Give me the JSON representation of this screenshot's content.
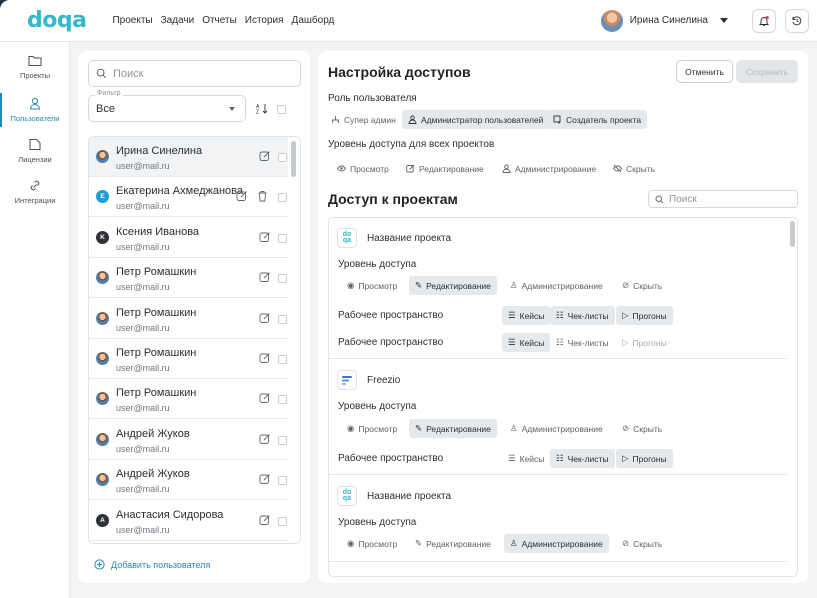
{
  "app": {
    "logo_text": "doqa"
  },
  "nav": [
    "Проекты",
    "Задачи",
    "Отчеты",
    "История",
    "Дашборд"
  ],
  "header": {
    "user_name": "Ирина Синелина"
  },
  "sidebar": {
    "items": [
      {
        "label": "Проекты",
        "icon": "folder-icon"
      },
      {
        "label": "Пользователи",
        "icon": "user-icon",
        "active": true
      },
      {
        "label": "Лицензии",
        "icon": "license-icon"
      },
      {
        "label": "Интеграции",
        "icon": "link-icon"
      }
    ]
  },
  "users_panel": {
    "search_placeholder": "Поиск",
    "filter_label": "Фильтр",
    "filter_value": "Все",
    "add_user_label": "Добавить пользователя",
    "users": [
      {
        "name": "Ирина Синелина",
        "email": "user@mail.ru",
        "avatar": "photo",
        "selected": true
      },
      {
        "name": "Екатерина Ахмеджанова",
        "email": "user@mail.ru",
        "avatar": "E"
      },
      {
        "name": "Ксения Иванова",
        "email": "user@mail.ru",
        "avatar": "K"
      },
      {
        "name": "Петр Ромашкин",
        "email": "user@mail.ru",
        "avatar": "photo"
      },
      {
        "name": "Петр Ромашкин",
        "email": "user@mail.ru",
        "avatar": "photo"
      },
      {
        "name": "Петр Ромашкин",
        "email": "user@mail.ru",
        "avatar": "photo"
      },
      {
        "name": "Петр Ромашкин",
        "email": "user@mail.ru",
        "avatar": "photo"
      },
      {
        "name": "Андрей Жуков",
        "email": "user@mail.ru",
        "avatar": "photo"
      },
      {
        "name": "Андрей Жуков",
        "email": "user@mail.ru",
        "avatar": "photo"
      },
      {
        "name": "Анастасия Сидорова",
        "email": "user@mail.ru",
        "avatar": "A"
      }
    ]
  },
  "access_settings": {
    "title": "Настройка доступов",
    "cancel_label": "Отменить",
    "save_label": "Сохранить",
    "role_label": "Роль пользователя",
    "roles": [
      "Супер админ",
      "Администратор пользователей",
      "Создатель проекта"
    ],
    "all_projects_label": "Уровень доступа для всех проектов",
    "levels": [
      "Просмотр",
      "Редактирование",
      "Администрирование",
      "Скрыть"
    ]
  },
  "project_access": {
    "title": "Доступ к проектам",
    "search_placeholder": "Поиск",
    "access_level_label": "Уровень доступа",
    "workspace_label": "Рабочее пространство",
    "workspace_chips": [
      "Кейсы",
      "Чек-листы",
      "Прогоны"
    ],
    "projects": [
      {
        "name": "Название проекта",
        "logo": "doqa"
      },
      {
        "name": "Freezio",
        "logo": "freezio"
      },
      {
        "name": "Название проекта",
        "logo": "doqa"
      }
    ]
  },
  "colors": {
    "accent": "#2a87b8",
    "brand": "#33b8cc",
    "selected_chip": "#e6e9ec"
  }
}
